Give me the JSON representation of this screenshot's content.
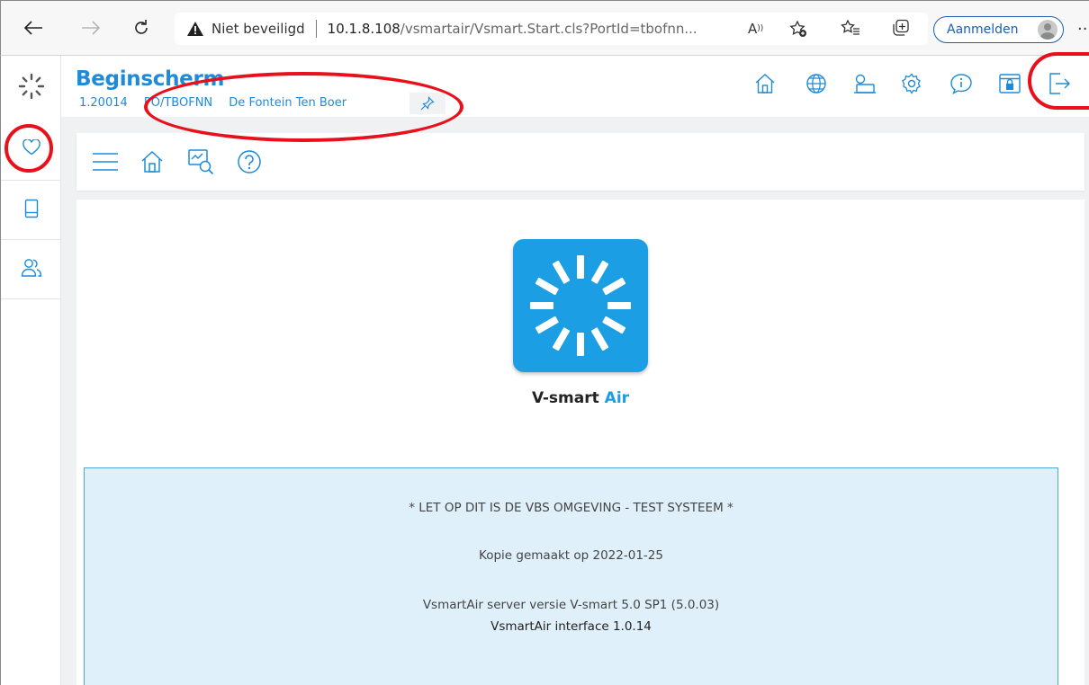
{
  "browser": {
    "security_label": "Niet beveiligd",
    "url_host": "10.1.8.108",
    "url_path": "/vsmartair/Vsmart.Start.cls?PortId=tbofnn...",
    "signin_label": "Aanmelden",
    "more_label": "···"
  },
  "header": {
    "title": "Beginscherm",
    "version": "1.20014",
    "org_code": "PO/TBOFNN",
    "org_name": "De Fontein Ten Boer"
  },
  "logo": {
    "name_part1": "V-smart",
    "name_part2": "Air"
  },
  "info": {
    "line1": "* LET OP DIT IS DE VBS OMGEVING - TEST SYSTEEM *",
    "line2": "Kopie gemaakt op 2022-01-25",
    "line3": "VsmartAir server versie V-smart 5.0 SP1 (5.0.03)",
    "line4": "VsmartAir interface 1.0.14"
  },
  "colors": {
    "accent": "#1e8bd8",
    "logo_bg": "#1b9ee3",
    "info_bg": "#dff0fa",
    "info_border": "#49a8df",
    "annotation": "#e8111b"
  },
  "icons": {
    "browser": [
      "back-arrow-icon",
      "forward-arrow-icon",
      "refresh-icon",
      "warning-icon",
      "read-aloud-icon",
      "add-favorite-icon",
      "favorites-icon",
      "collections-icon",
      "profile-avatar-icon"
    ],
    "rail": [
      "vsmart-logo-icon",
      "heart-icon",
      "book-icon",
      "users-icon"
    ],
    "header": [
      "home-icon",
      "globe-icon",
      "user-screen-icon",
      "gear-icon",
      "info-icon",
      "lock-screen-icon",
      "logout-icon"
    ],
    "toolbar": [
      "menu-icon",
      "home-icon",
      "screen-search-icon",
      "help-icon"
    ]
  }
}
